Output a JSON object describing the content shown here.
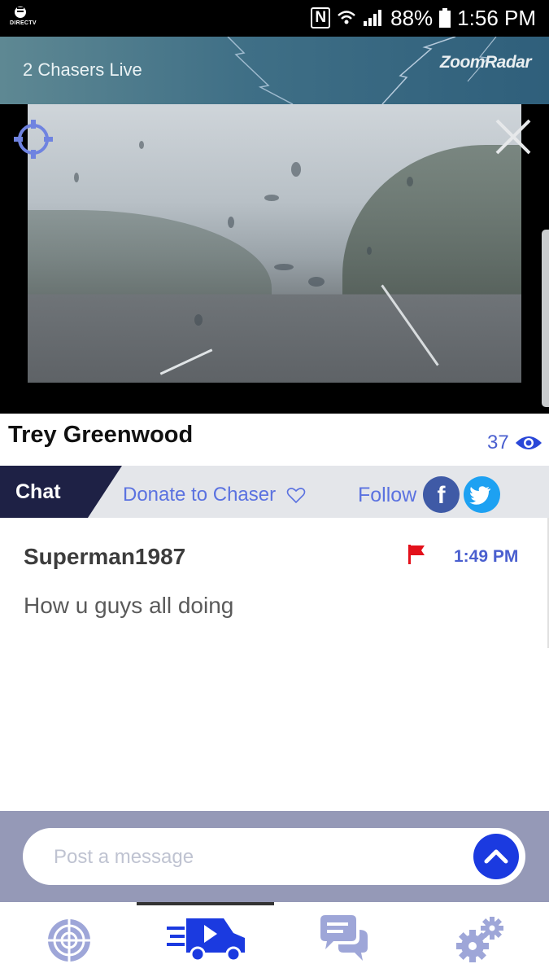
{
  "status_bar": {
    "carrier": "DIRECTV",
    "nfc": "N",
    "battery": "88%",
    "time": "1:56 PM"
  },
  "header": {
    "chasers_live": "2 Chasers Live",
    "brand": "ZoomRadar"
  },
  "chaser": {
    "name": "Trey Greenwood",
    "viewers": "37"
  },
  "tabs": {
    "chat": "Chat",
    "donate": "Donate to Chaser",
    "follow": "Follow",
    "facebook_glyph": "f"
  },
  "messages": [
    {
      "user": "Superman1987",
      "time": "1:49 PM",
      "text": "How u guys all doing"
    }
  ],
  "compose": {
    "placeholder": "Post a message"
  },
  "nav": {
    "items": [
      "radar-target-icon",
      "chaser-van-icon",
      "chat-bubbles-icon",
      "settings-gears-icon"
    ],
    "active_index": 1
  },
  "colors": {
    "accent": "#4a5fcf",
    "chat_tab": "#1e2145",
    "compose_bar": "#9599b7",
    "send_button": "#1b3ae0",
    "flag": "#e3111b"
  }
}
